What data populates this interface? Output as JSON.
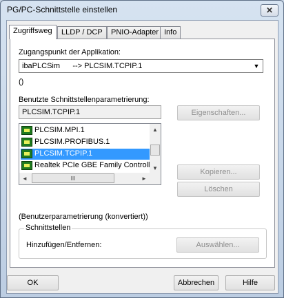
{
  "window": {
    "title": "PG/PC-Schnittstelle einstellen",
    "close_glyph": "✕"
  },
  "tabs": [
    {
      "label": "Zugriffsweg",
      "active": true
    },
    {
      "label": "LLDP / DCP",
      "active": false
    },
    {
      "label": "PNIO-Adapter",
      "active": false
    },
    {
      "label": "Info",
      "active": false
    }
  ],
  "access_point": {
    "label": "Zugangspunkt der Applikation:",
    "value": "ibaPLCSim      --> PLCSIM.TCPIP.1",
    "note": "()"
  },
  "interface_param": {
    "label": "Benutzte Schnittstellenparametrierung:",
    "current": "PLCSIM.TCPIP.1",
    "items": [
      {
        "label": "PLCSIM.MPI.1",
        "selected": false
      },
      {
        "label": "PLCSIM.PROFIBUS.1",
        "selected": false
      },
      {
        "label": "PLCSIM.TCPIP.1",
        "selected": true
      },
      {
        "label": "Realtek PCIe GBE Family Controller",
        "selected": false
      }
    ],
    "status": "(Benutzerparametrierung (konvertiert))"
  },
  "buttons": {
    "properties": "Eigenschaften...",
    "copy": "Kopieren...",
    "delete": "Löschen",
    "select": "Auswählen...",
    "ok": "OK",
    "cancel": "Abbrechen",
    "help": "Hilfe"
  },
  "interfaces_group": {
    "legend": "Schnittstellen",
    "label": "Hinzufügen/Entfernen:"
  },
  "scroll_glyphs": {
    "up": "▲",
    "down": "▼",
    "left": "◄",
    "right": "►",
    "grip": "III"
  }
}
